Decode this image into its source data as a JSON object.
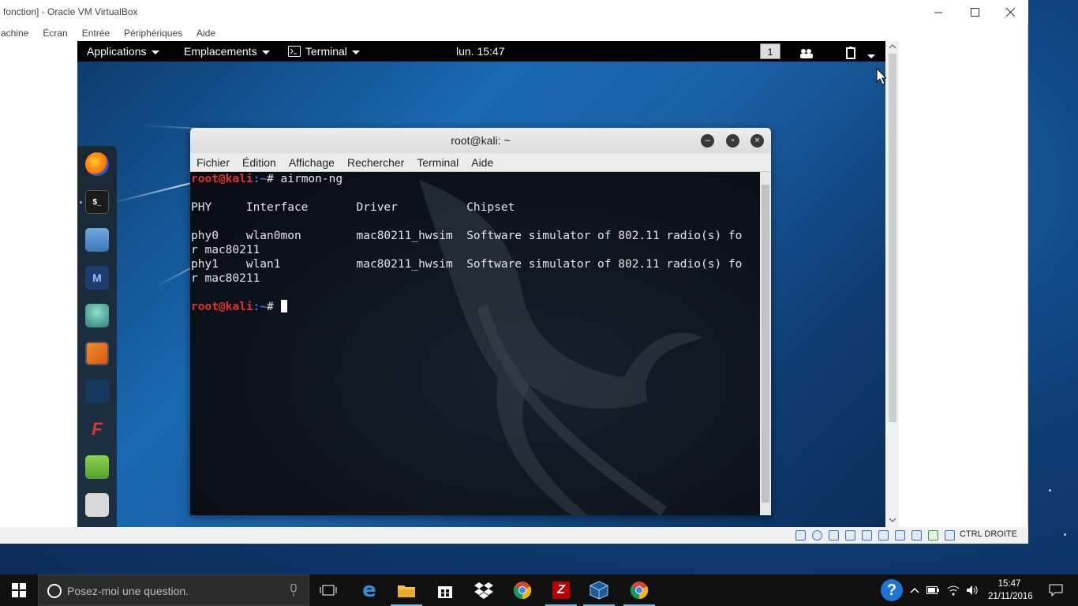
{
  "host_window": {
    "title": "fonction] - Oracle VM VirtualBox",
    "menu": [
      "Machine",
      "Écran",
      "Entrée",
      "Périphériques",
      "Aide"
    ]
  },
  "guest": {
    "topbar": {
      "applications": "Applications",
      "places": "Emplacements",
      "terminal": "Terminal",
      "clock": "lun. 15:47",
      "workspace": "1"
    },
    "dock_items": [
      {
        "name": "firefox-icon",
        "label": ""
      },
      {
        "name": "terminal-icon",
        "label": "$_"
      },
      {
        "name": "files-icon",
        "label": ""
      },
      {
        "name": "metasploit-icon",
        "label": "M"
      },
      {
        "name": "armitage-icon",
        "label": ""
      },
      {
        "name": "burpsuite-icon",
        "label": ""
      },
      {
        "name": "beef-icon",
        "label": ""
      },
      {
        "name": "faraday-icon",
        "label": "F"
      },
      {
        "name": "leafpad-icon",
        "label": ""
      },
      {
        "name": "show-apps-icon",
        "label": ""
      }
    ],
    "terminal_window": {
      "title": "root@kali: ~",
      "menu": [
        "Fichier",
        "Édition",
        "Affichage",
        "Rechercher",
        "Terminal",
        "Aide"
      ],
      "prompt_user": "root@kali",
      "prompt_path": ":~",
      "prompt_symbol": "# ",
      "command": "airmon-ng",
      "output_lines": [
        "",
        "PHY     Interface       Driver          Chipset",
        "",
        "phy0    wlan0mon        mac80211_hwsim  Software simulator of 802.11 radio(s) fo",
        "r mac80211",
        "phy1    wlan1           mac80211_hwsim  Software simulator of 802.11 radio(s) fo",
        "r mac80211",
        ""
      ]
    }
  },
  "vbox_status": {
    "host_key": "CTRL DROITE"
  },
  "taskbar": {
    "search_placeholder": "Posez-moi une question.",
    "apps": [
      "task-view-icon",
      "edge-icon",
      "file-explorer-icon",
      "store-icon",
      "dropbox-icon",
      "chrome-icon",
      "filezilla-icon",
      "virtualbox-icon",
      "chrome-icon-2"
    ],
    "time": "15:47",
    "date": "21/11/2016"
  },
  "colors": {
    "prompt_user": "#e8322e",
    "prompt_path": "#3d6dd9",
    "taskbar": "#101010",
    "desktop": "#0f3f78"
  }
}
